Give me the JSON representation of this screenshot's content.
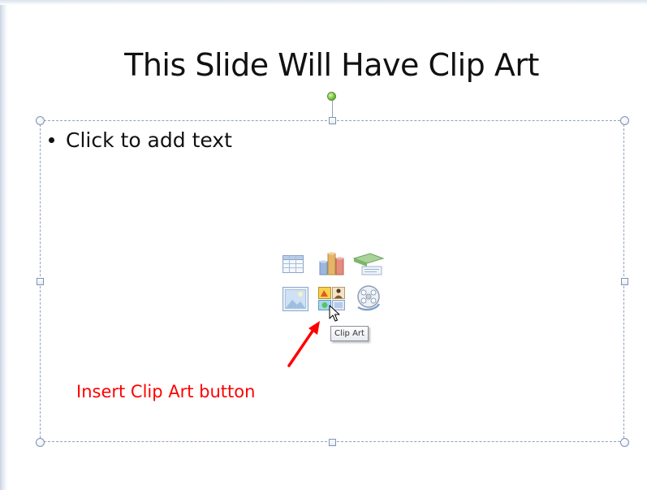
{
  "slide": {
    "title": "This Slide Will Have Clip Art",
    "content_placeholder": {
      "bullet_text": "Click to add text"
    }
  },
  "content_icons": [
    {
      "name": "insert-table-icon",
      "active": false
    },
    {
      "name": "insert-chart-icon",
      "active": false
    },
    {
      "name": "insert-smartart-icon",
      "active": false
    },
    {
      "name": "insert-picture-icon",
      "active": false
    },
    {
      "name": "insert-clip-art-icon",
      "active": true
    },
    {
      "name": "insert-media-clip-icon",
      "active": false
    }
  ],
  "tooltip": {
    "text": "Clip Art"
  },
  "annotation": {
    "text": "Insert Clip Art button",
    "color": "#ff0000"
  },
  "colors": {
    "placeholder_border": "#8ea2bf",
    "rotate_handle": "#6fc034"
  }
}
